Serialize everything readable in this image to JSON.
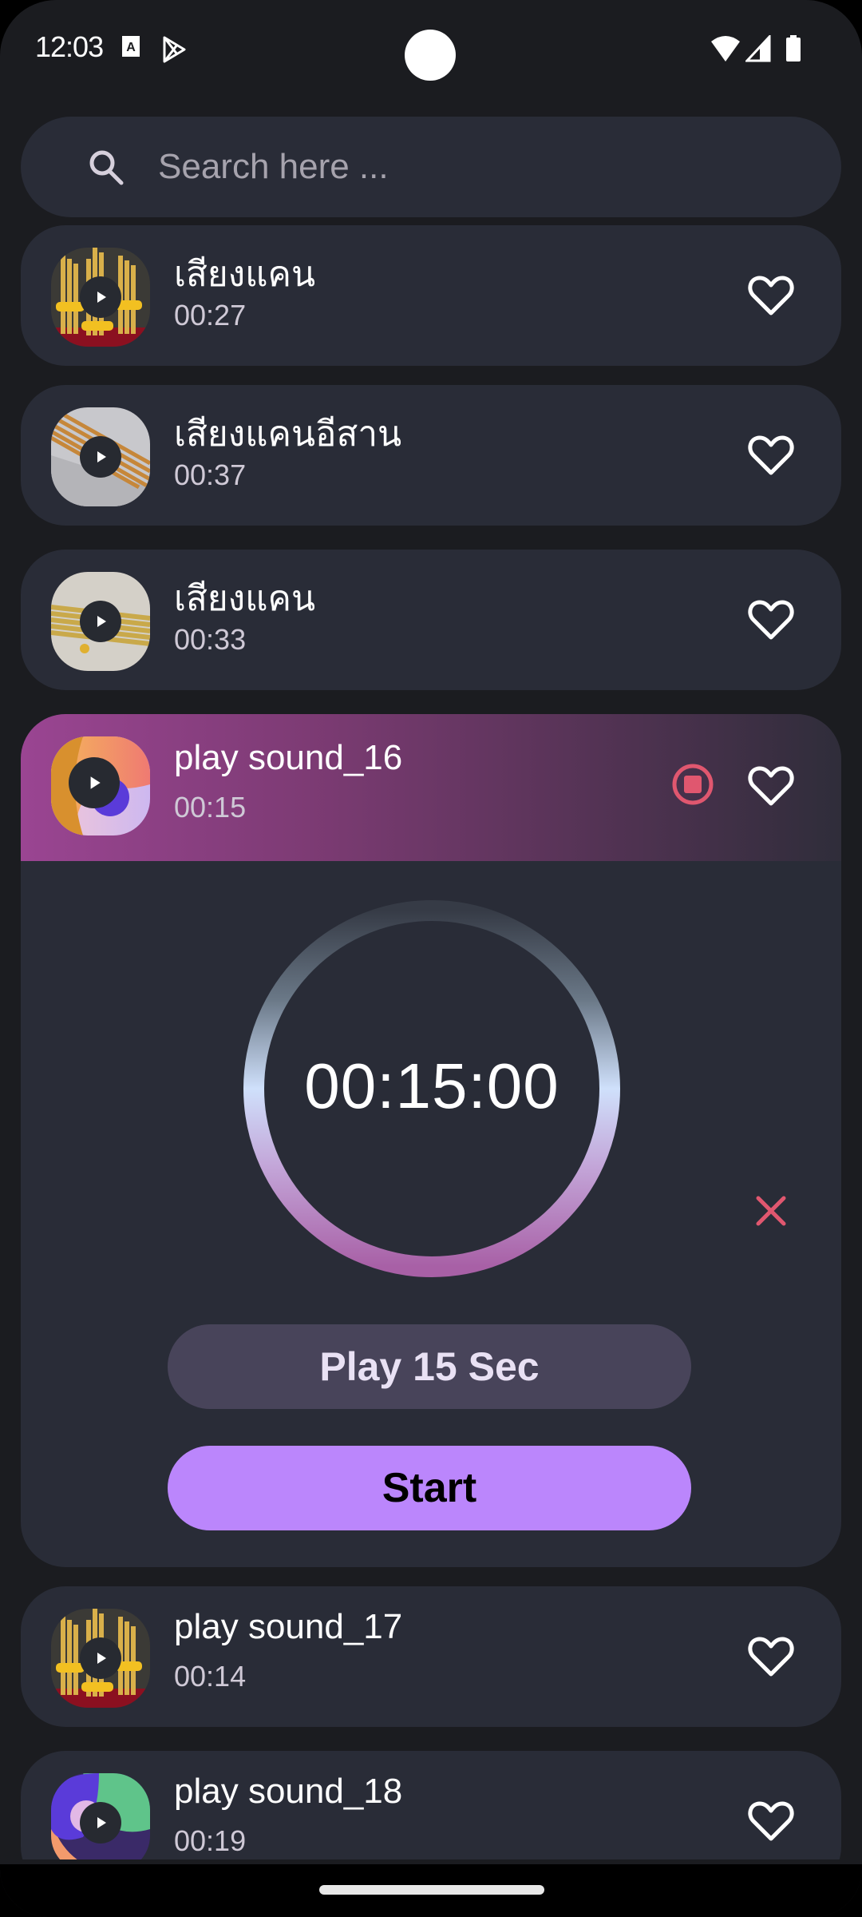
{
  "status_bar": {
    "time": "12:03",
    "left_icons": [
      "accessibility-a-icon",
      "play-store-icon"
    ],
    "right_icons": [
      "wifi-icon",
      "cell-signal-icon",
      "battery-icon"
    ]
  },
  "search": {
    "placeholder": "Search here ...",
    "value": ""
  },
  "sounds": [
    {
      "title": "เสียงแคน",
      "duration": "00:27",
      "thumbnail": "khaen-instrument-stand",
      "favorite": false
    },
    {
      "title": "เสียงแคนอีสาน",
      "duration": "00:37",
      "thumbnail": "khaen-pipes-orange",
      "favorite": false
    },
    {
      "title": "เสียงแคน",
      "duration": "00:33",
      "thumbnail": "khaen-pipes-yellow",
      "favorite": false
    },
    {
      "title": "play sound_16",
      "duration": "00:15",
      "thumbnail": "abstract-orange-purple",
      "favorite": false,
      "playing": true
    },
    {
      "title": "play sound_17",
      "duration": "00:14",
      "thumbnail": "khaen-instrument-stand",
      "favorite": false
    },
    {
      "title": "play sound_18",
      "duration": "00:19",
      "thumbnail": "abstract-green-purple",
      "favorite": false
    }
  ],
  "player": {
    "timer": "00:15:00",
    "duration_button": "Play 15 Sec",
    "start_button": "Start"
  },
  "colors": {
    "background": "#1b1c20",
    "card": "#292c37",
    "accent": "#bb86fc",
    "stop": "#e0576f",
    "header_gradient_start": "#9a4592"
  }
}
